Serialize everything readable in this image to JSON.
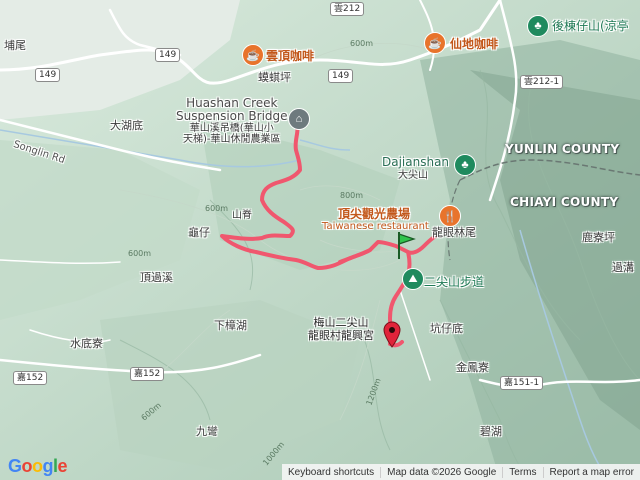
{
  "colors": {
    "route": "#f0576e",
    "start_marker": "#2fc44b",
    "end_marker": "#e0243a",
    "restaurant_pin": "#e8742c",
    "park_pin": "#1f8a5e",
    "road": "#ffffff",
    "county_line": "#6a7873"
  },
  "labels": {
    "tuanwei": "埔尾",
    "yunding_cafe": "雲頂咖啡",
    "mayiping": "蟆蜞坪",
    "xiandi_cafe": "仙地咖啡",
    "houlizi": "後棟仔山(涼亭",
    "bridge_en_1": "Huashan Creek",
    "bridge_en_2": "Suspension Bridge",
    "bridge_zh_1": "華山溪吊橋(華山小",
    "bridge_zh_2": "天梯)-華山休閒農業區",
    "dahudi": "大湖底",
    "songlin_rd": "Songlin Rd",
    "dajianshan_en": "Dajianshan",
    "dajianshan_zh": "大尖山",
    "yunlin_county": "YUNLIN COUNTY",
    "chiayi_county": "CHIAYI COUNTY",
    "dingjian_farm": "頂尖觀光農場",
    "taiwanese_restaurant": "Taiwanese restaurant",
    "shanjiao": "山脊",
    "guizai": "龜仔",
    "longyanlinwei": "龍眼林尾",
    "luliaoping": "鹿寮坪",
    "guoshuliao": "過溝",
    "dingguoxi": "頂過溪",
    "erjianshan_trail": "二尖山步道",
    "xiazhanghu": "下樟湖",
    "temple_1": "梅山二尖山",
    "temple_2": "龍眼村龍興宮",
    "kengzaidi": "坑仔底",
    "shuidiliao": "水底寮",
    "jinfengliao": "金鳳寮",
    "jiuwan": "九彎",
    "bihu": "碧湖"
  },
  "contours": {
    "c_600_a": "600m",
    "c_600_b": "600m",
    "c_800_a": "800m",
    "c_600_c": "600m",
    "c_1000": "1000m",
    "c_1200": "1200m",
    "c_600_d": "600m"
  },
  "shields": {
    "r212_top": "雲212",
    "r149_a": "149",
    "r149_b": "149",
    "r149_c": "149",
    "r212_1": "雲212-1",
    "r152_a": "嘉152",
    "r152_b": "嘉152",
    "r151_1": "嘉151-1"
  },
  "footer": {
    "logo": "Google",
    "shortcuts": "Keyboard shortcuts",
    "map_data": "Map data ©2026 Google",
    "terms": "Terms",
    "report": "Report a map error"
  }
}
